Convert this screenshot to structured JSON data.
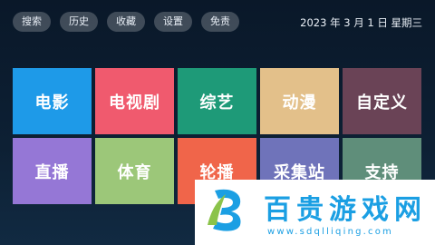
{
  "nav": {
    "items": [
      {
        "label": "搜索",
        "name": "nav-search-button"
      },
      {
        "label": "历史",
        "name": "nav-history-button"
      },
      {
        "label": "收藏",
        "name": "nav-favorites-button"
      },
      {
        "label": "设置",
        "name": "nav-settings-button"
      },
      {
        "label": "免责",
        "name": "nav-disclaimer-button"
      }
    ]
  },
  "status": {
    "datetime": "2023 年 3 月 1 日 星期三"
  },
  "tiles": [
    {
      "label": "电影",
      "color": "#1e9ae8"
    },
    {
      "label": "电视剧",
      "color": "#f05a6e"
    },
    {
      "label": "综艺",
      "color": "#1e9a78"
    },
    {
      "label": "动漫",
      "color": "#e3c08a"
    },
    {
      "label": "自定义",
      "color": "#6a4356"
    },
    {
      "label": "直播",
      "color": "#9577d6"
    },
    {
      "label": "体育",
      "color": "#9cc779"
    },
    {
      "label": "轮播",
      "color": "#f0654a"
    },
    {
      "label": "采集站",
      "color": "#6f73ba"
    },
    {
      "label": "支持",
      "color": "#5f8e7a"
    }
  ],
  "watermark": {
    "title": "百贵游戏网",
    "url": "www.sdqlliqing.com"
  }
}
